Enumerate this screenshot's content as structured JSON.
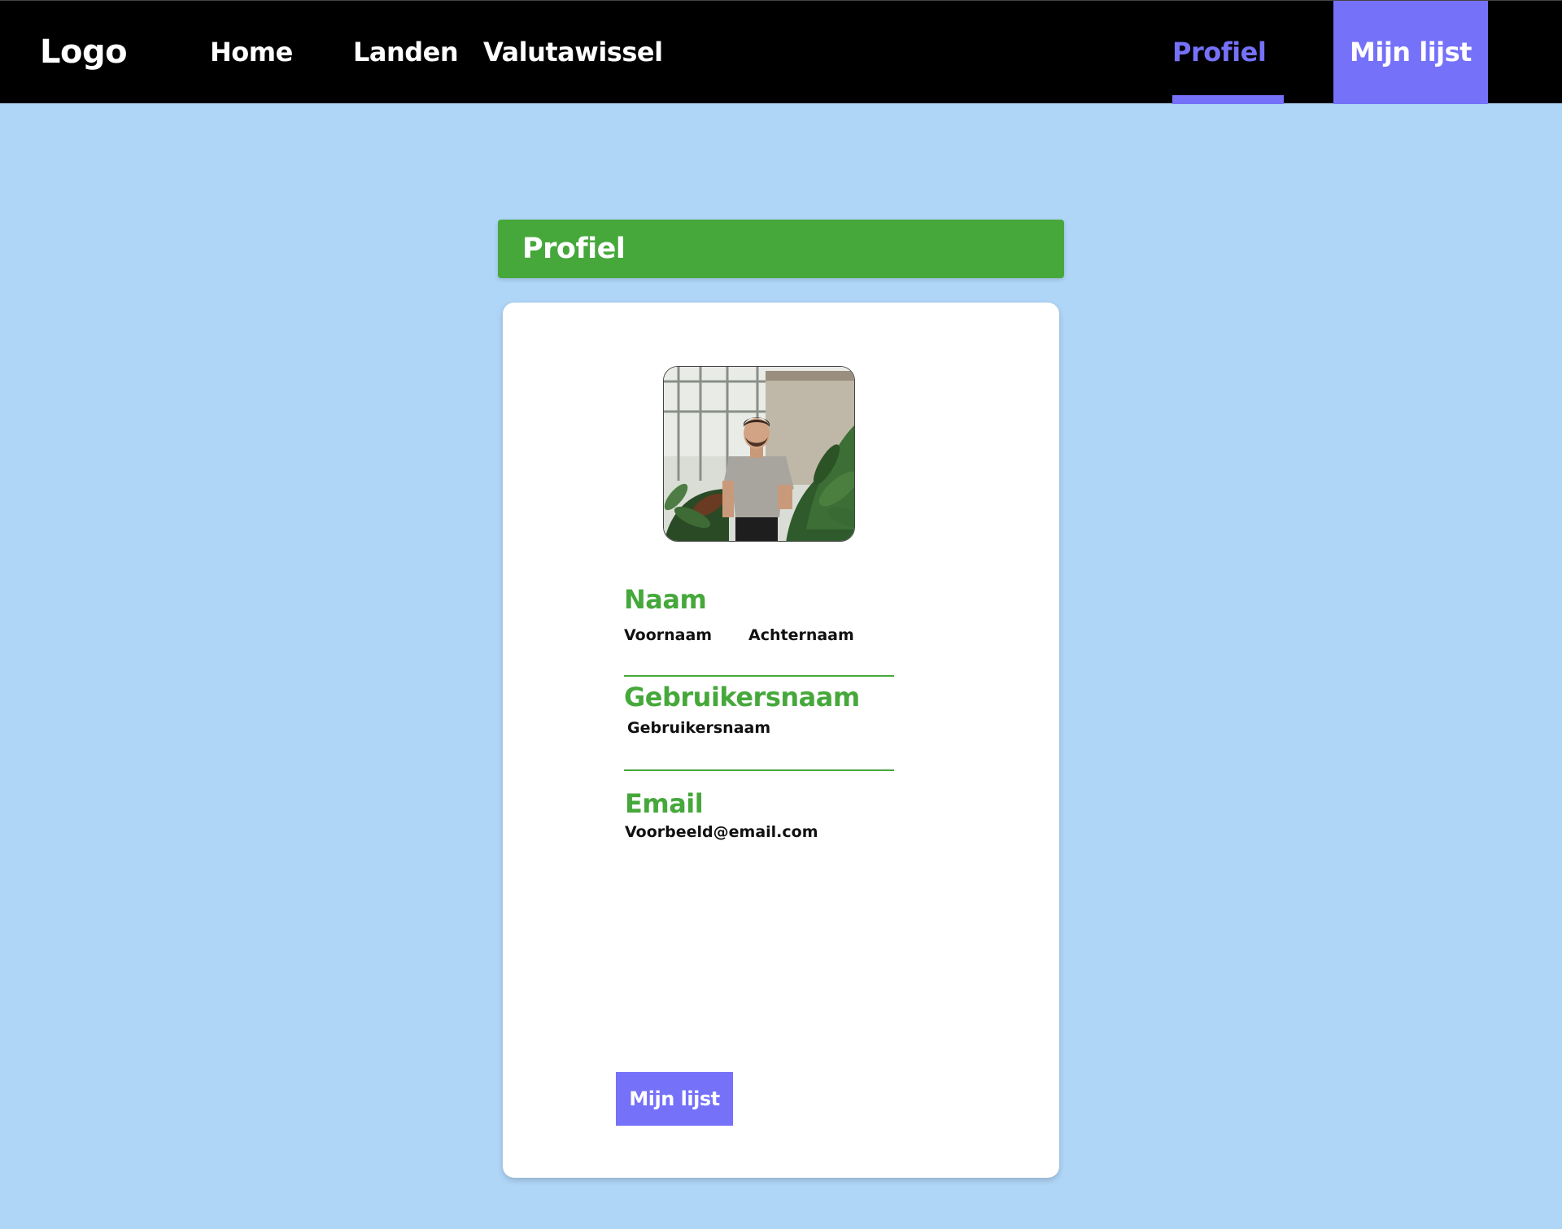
{
  "navbar": {
    "logo": "Logo",
    "links": [
      {
        "label": "Home"
      },
      {
        "label": "Landen"
      },
      {
        "label": "Valutawissel"
      }
    ],
    "active_link": "Profiel",
    "cta": "Mijn lijst",
    "accent_color": "#7571f9"
  },
  "profile": {
    "header_title": "Profiel",
    "header_color": "#46a83b",
    "avatar_icon": "profile-photo",
    "name_label": "Naam",
    "first_name": "Voornaam",
    "last_name": "Achternaam",
    "username_label": "Gebruikersnaam",
    "username": "Gebruikersnaam",
    "email_label": "Email",
    "email": "Voorbeeld@email.com",
    "button_label": "Mijn lijst"
  },
  "colors": {
    "background": "#b0d6f7",
    "navbar": "#000000",
    "accent": "#7571f9",
    "green": "#46a83b"
  }
}
